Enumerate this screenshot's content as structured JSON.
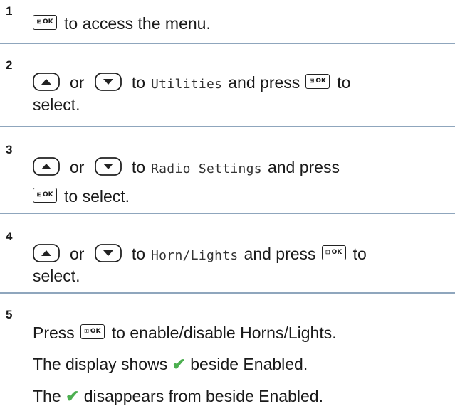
{
  "ok_key": {
    "grid": "⊞",
    "label": "OK"
  },
  "step1": {
    "num": "1",
    "text": "to access the menu."
  },
  "step2": {
    "num": "2",
    "or": "or",
    "to": "to",
    "item": "Utilities",
    "press": "and press",
    "to2": "to",
    "cont": "select."
  },
  "step3": {
    "num": "3",
    "or": "or",
    "to": "to",
    "item": "Radio Settings",
    "press": "and press",
    "cont": "to select."
  },
  "step4": {
    "num": "4",
    "or": "or",
    "to": "to",
    "item": "Horn/Lights",
    "press": "and press",
    "to2": "to",
    "cont": "select."
  },
  "step5": {
    "num": "5",
    "press": "Press",
    "action": "to enable/disable Horns/Lights.",
    "line2_a": "The display shows",
    "line2_b": "beside Enabled.",
    "line3_a": "The",
    "line3_b": "disappears from beside Enabled.",
    "check_glyph": "✔",
    "check_color": "#4caf50"
  }
}
